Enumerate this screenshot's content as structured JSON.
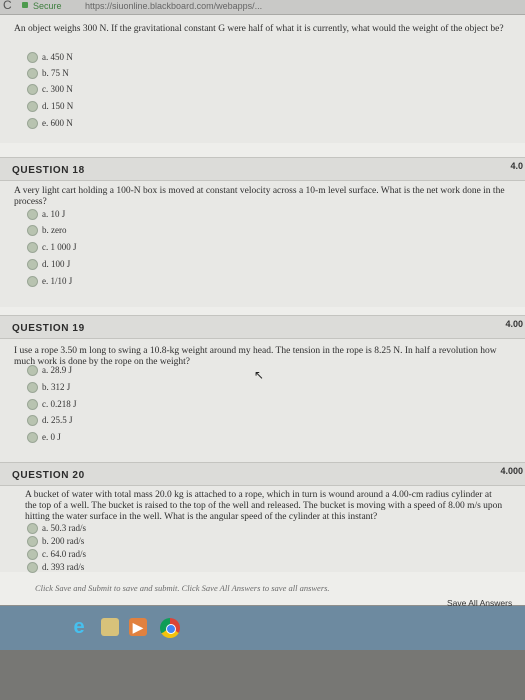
{
  "browser": {
    "reload_icon": "reload-icon",
    "secure_label": "Secure",
    "url": "https://siuonline.blackboard.com/webapps/..."
  },
  "q17": {
    "text": "An object weighs 300 N. If the gravitational constant G were half of what it is currently, what would the weight of the object be?",
    "options": [
      "a. 450 N",
      "b. 75 N",
      "c. 300 N",
      "d. 150 N",
      "e. 600 N"
    ]
  },
  "q18": {
    "title": "QUESTION 18",
    "points": "4.0",
    "text": "A very light cart holding a 100-N box is moved at constant velocity across a 10-m level surface. What is the net work done in the process?",
    "options": [
      "a. 10 J",
      "b. zero",
      "c. 1 000 J",
      "d. 100 J",
      "e. 1/10 J"
    ]
  },
  "q19": {
    "title": "QUESTION 19",
    "points": "4.00",
    "text": "I use a rope 3.50 m long to swing a 10.8-kg weight around my head. The tension in the rope is 8.25 N. In half a revolution how much work is done by the rope on the weight?",
    "options": [
      "a. 28.9 J",
      "b. 312 J",
      "c. 0.218 J",
      "d. 25.5 J",
      "e. 0 J"
    ]
  },
  "q20": {
    "title": "QUESTION 20",
    "points": "4.000",
    "text": "A bucket of water with total mass 20.0 kg is attached to a rope, which in turn is wound around a 4.00-cm radius cylinder at the top of a well. The bucket is raised to the top of the well and released. The bucket is moving with a speed of 8.00 m/s upon hitting the water surface in the well. What is the angular speed of the cylinder at this instant?",
    "options": [
      "a. 50.3 rad/s",
      "b. 200 rad/s",
      "c. 64.0 rad/s",
      "d. 393 rad/s"
    ]
  },
  "footer": {
    "note": "Click Save and Submit to save and submit. Click Save All Answers to save all answers.",
    "save_all": "Save All Answers"
  },
  "taskbar": {
    "icons": [
      "internet-explorer-icon",
      "file-explorer-icon",
      "media-player-icon",
      "chrome-icon"
    ]
  }
}
